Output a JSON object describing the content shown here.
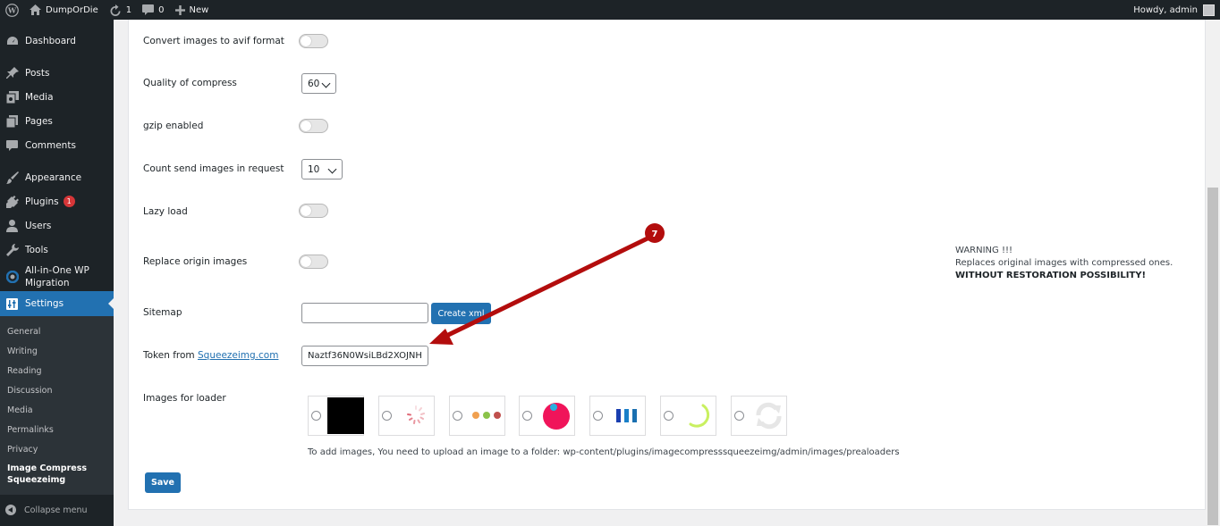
{
  "adminbar": {
    "site_name": "DumpOrDie",
    "updates_count": "1",
    "comments_count": "0",
    "new_label": "New",
    "howdy": "Howdy, admin"
  },
  "sidebar": {
    "items": [
      {
        "label": "Dashboard",
        "icon": "dashboard-icon"
      },
      {
        "label": "Posts",
        "icon": "pin-icon"
      },
      {
        "label": "Media",
        "icon": "media-icon"
      },
      {
        "label": "Pages",
        "icon": "pages-icon"
      },
      {
        "label": "Comments",
        "icon": "comments-icon"
      },
      {
        "label": "Appearance",
        "icon": "brush-icon"
      },
      {
        "label": "Plugins",
        "icon": "plug-icon",
        "badge": "1"
      },
      {
        "label": "Users",
        "icon": "user-icon"
      },
      {
        "label": "Tools",
        "icon": "wrench-icon"
      },
      {
        "label": "All-in-One WP Migration",
        "icon": "migration-icon"
      },
      {
        "label": "Settings",
        "icon": "settings-icon"
      }
    ],
    "submenu": [
      "General",
      "Writing",
      "Reading",
      "Discussion",
      "Media",
      "Permalinks",
      "Privacy",
      "Image Compress Squeezeimg"
    ],
    "collapse_label": "Collapse menu"
  },
  "form": {
    "avif_label": "Convert images to avif format",
    "quality_label": "Quality of compress",
    "quality_value": "60",
    "gzip_label": "gzip enabled",
    "count_label": "Count send images in request",
    "count_value": "10",
    "lazy_label": "Lazy load",
    "replace_label": "Replace origin images",
    "warning_line1": "WARNING !!!",
    "warning_line2": "Replaces original images with compressed ones.",
    "warning_line3": "WITHOUT RESTORATION POSSIBILITY!",
    "sitemap_label": "Sitemap",
    "sitemap_value": "",
    "create_xml_label": "Create xml",
    "token_label_prefix": "Token from",
    "token_link": "Squeezeimg.com",
    "token_value": "Naztf36N0WsiLBd2XOJNH",
    "loader_label": "Images for loader",
    "loader_help": "To add images, You need to upload an image to a folder: wp-content/plugins/imagecompresssqueezeimg/admin/images/prealoaders",
    "save_label": "Save"
  },
  "annotation": {
    "step_number": "7",
    "color": "#b30d0d"
  }
}
